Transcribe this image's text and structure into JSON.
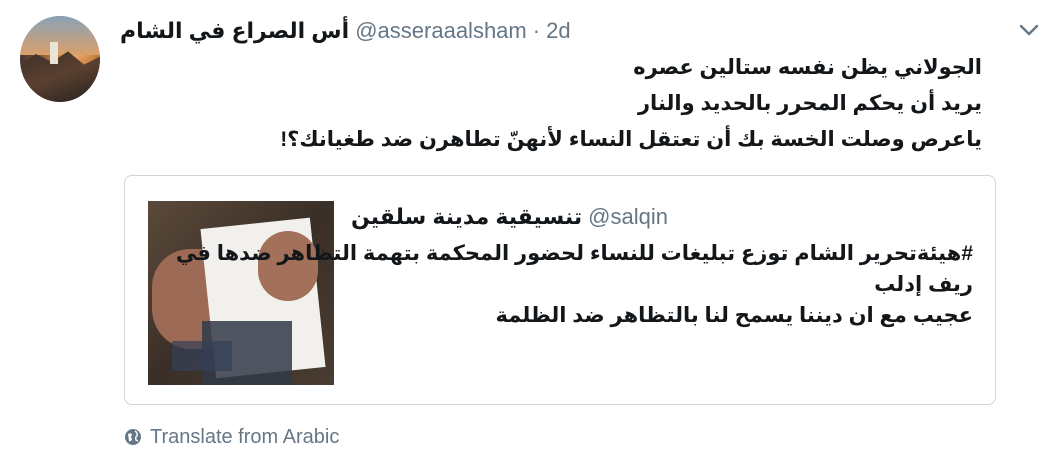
{
  "tweet": {
    "display_name": "أس الصراع في الشام",
    "handle": "@asseraaalsham",
    "separator": "·",
    "time": "2d",
    "lines": [
      "الجولاني يظن نفسه ستالين عصره",
      "يريد أن يحكم المحرر بالحديد والنار",
      "ياعرص وصلت الخسة بك أن تعتقل النساء لأنهنّ تطاهرن ضد طغيانك؟!"
    ]
  },
  "quoted": {
    "display_name": "تنسيقية مدينة سلقين",
    "handle": "@salqin",
    "lines": [
      "#هيئةتحرير الشام توزع تبليغات للنساء لحضور المحكمة بتهمة التظاهر ضدها في",
      "ريف إدلب",
      "عجيب مع ان ديننا يسمح لنا بالتظاهر  ضد الظلمة"
    ]
  },
  "translate": {
    "label": "Translate from Arabic"
  },
  "icons": {
    "menu": "chevron-down-icon",
    "translate": "globe-icon"
  },
  "colors": {
    "text": "#14171a",
    "secondary": "#657786",
    "border": "#ccd6dd"
  }
}
